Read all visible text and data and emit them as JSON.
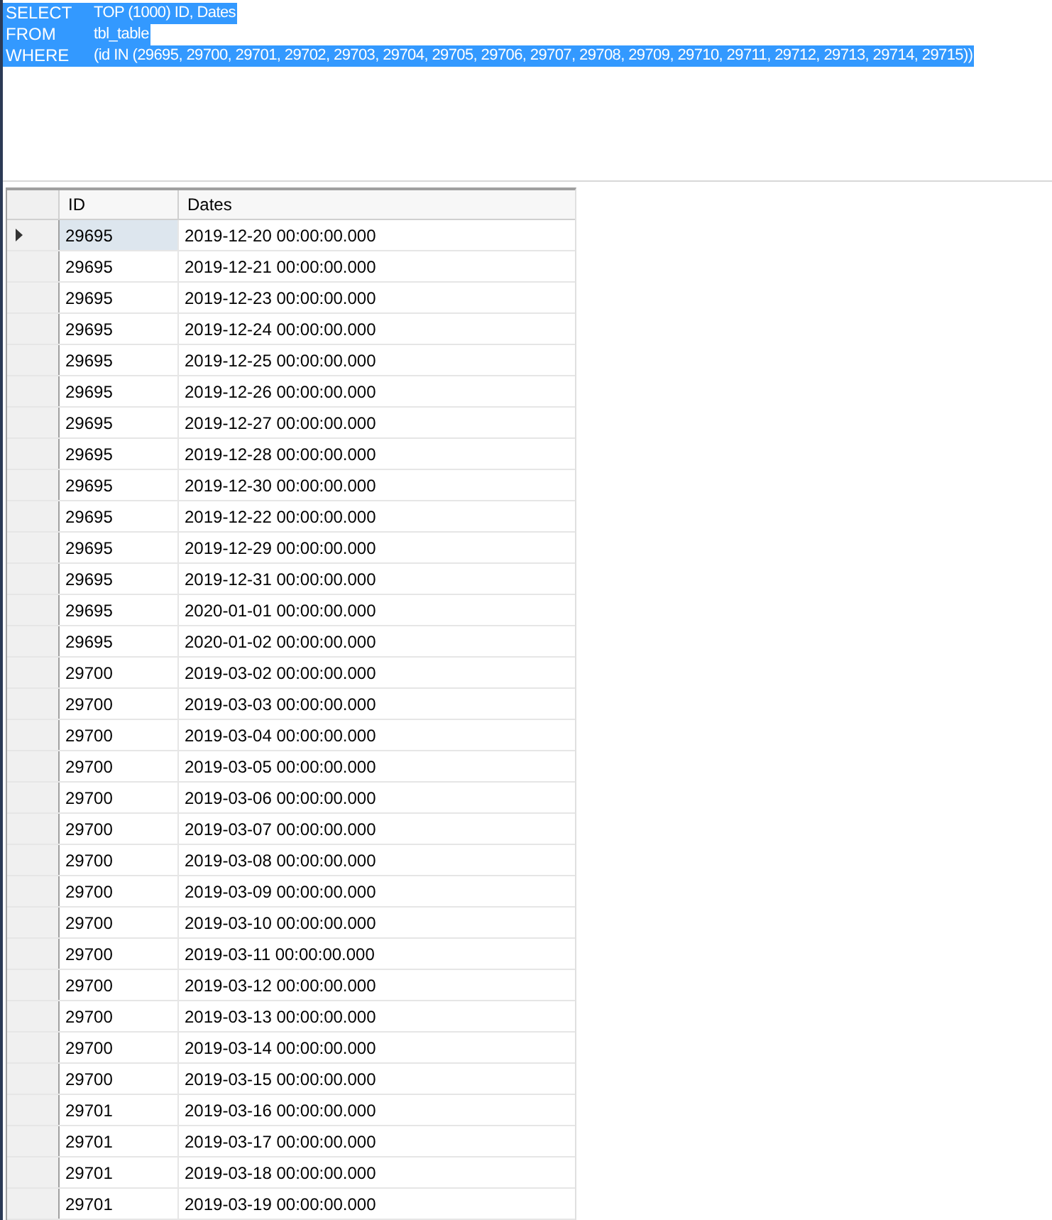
{
  "query": {
    "highlighted": true,
    "lines": [
      {
        "keyword": "SELECT",
        "text": "TOP (1000) ID, Dates"
      },
      {
        "keyword": "FROM",
        "text": "tbl_table"
      },
      {
        "keyword": "WHERE",
        "text": "(id IN (29695, 29700, 29701, 29702, 29703, 29704, 29705, 29706, 29707, 29708, 29709, 29710, 29711, 29712, 29713, 29714, 29715))"
      }
    ]
  },
  "results": {
    "columns": [
      "ID",
      "Dates"
    ],
    "rows": [
      {
        "id": "29695",
        "date": "2019-12-20 00:00:00.000",
        "selected": true
      },
      {
        "id": "29695",
        "date": "2019-12-21 00:00:00.000",
        "selected": false
      },
      {
        "id": "29695",
        "date": "2019-12-23 00:00:00.000",
        "selected": false
      },
      {
        "id": "29695",
        "date": "2019-12-24 00:00:00.000",
        "selected": false
      },
      {
        "id": "29695",
        "date": "2019-12-25 00:00:00.000",
        "selected": false
      },
      {
        "id": "29695",
        "date": "2019-12-26 00:00:00.000",
        "selected": false
      },
      {
        "id": "29695",
        "date": "2019-12-27 00:00:00.000",
        "selected": false
      },
      {
        "id": "29695",
        "date": "2019-12-28 00:00:00.000",
        "selected": false
      },
      {
        "id": "29695",
        "date": "2019-12-30 00:00:00.000",
        "selected": false
      },
      {
        "id": "29695",
        "date": "2019-12-22 00:00:00.000",
        "selected": false
      },
      {
        "id": "29695",
        "date": "2019-12-29 00:00:00.000",
        "selected": false
      },
      {
        "id": "29695",
        "date": "2019-12-31 00:00:00.000",
        "selected": false
      },
      {
        "id": "29695",
        "date": "2020-01-01 00:00:00.000",
        "selected": false
      },
      {
        "id": "29695",
        "date": "2020-01-02 00:00:00.000",
        "selected": false
      },
      {
        "id": "29700",
        "date": "2019-03-02 00:00:00.000",
        "selected": false
      },
      {
        "id": "29700",
        "date": "2019-03-03 00:00:00.000",
        "selected": false
      },
      {
        "id": "29700",
        "date": "2019-03-04 00:00:00.000",
        "selected": false
      },
      {
        "id": "29700",
        "date": "2019-03-05 00:00:00.000",
        "selected": false
      },
      {
        "id": "29700",
        "date": "2019-03-06 00:00:00.000",
        "selected": false
      },
      {
        "id": "29700",
        "date": "2019-03-07 00:00:00.000",
        "selected": false
      },
      {
        "id": "29700",
        "date": "2019-03-08 00:00:00.000",
        "selected": false
      },
      {
        "id": "29700",
        "date": "2019-03-09 00:00:00.000",
        "selected": false
      },
      {
        "id": "29700",
        "date": "2019-03-10 00:00:00.000",
        "selected": false
      },
      {
        "id": "29700",
        "date": "2019-03-11 00:00:00.000",
        "selected": false
      },
      {
        "id": "29700",
        "date": "2019-03-12 00:00:00.000",
        "selected": false
      },
      {
        "id": "29700",
        "date": "2019-03-13 00:00:00.000",
        "selected": false
      },
      {
        "id": "29700",
        "date": "2019-03-14 00:00:00.000",
        "selected": false
      },
      {
        "id": "29700",
        "date": "2019-03-15 00:00:00.000",
        "selected": false
      },
      {
        "id": "29701",
        "date": "2019-03-16 00:00:00.000",
        "selected": false
      },
      {
        "id": "29701",
        "date": "2019-03-17 00:00:00.000",
        "selected": false
      },
      {
        "id": "29701",
        "date": "2019-03-18 00:00:00.000",
        "selected": false
      },
      {
        "id": "29701",
        "date": "2019-03-19 00:00:00.000",
        "selected": false
      }
    ]
  }
}
